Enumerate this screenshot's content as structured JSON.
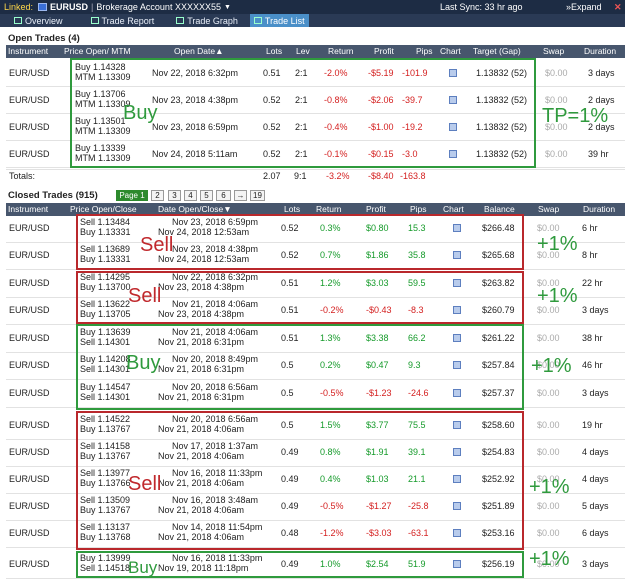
{
  "topbar": {
    "linked": "Linked:",
    "symbol": "EURUSD",
    "sep": "|",
    "account": "Brokerage Account XXXXXX55",
    "sync": "Last Sync: 33 hr ago",
    "expand": "»Expand",
    "close": "✕"
  },
  "tabs": [
    {
      "label": "Overview"
    },
    {
      "label": "Trade Report"
    },
    {
      "label": "Trade Graph"
    },
    {
      "label": "Trade List"
    }
  ],
  "open": {
    "title": "Open Trades (4)",
    "headers": [
      "Instrument",
      "Price Open/ MTM",
      "Open Date▲",
      "Lots",
      "Lev",
      "Return",
      "Profit",
      "Pips",
      "Chart",
      "Target (Gap)",
      "Swap",
      "Duration"
    ],
    "rows": [
      {
        "inst": "EUR/USD",
        "p1": "Buy 1.14328",
        "p2": "MTM 1.13309",
        "date": "Nov 22, 2018 6:32pm",
        "lots": "0.51",
        "lev": "2:1",
        "ret": "-2.0%",
        "profit": "-$5.19",
        "pips": "-101.9",
        "target": "1.13832 (52)",
        "swap": "$0.00",
        "dur": "3 days"
      },
      {
        "inst": "EUR/USD",
        "p1": "Buy 1.13706",
        "p2": "MTM 1.13309",
        "date": "Nov 23, 2018 4:38pm",
        "lots": "0.52",
        "lev": "2:1",
        "ret": "-0.8%",
        "profit": "-$2.06",
        "pips": "-39.7",
        "target": "1.13832 (52)",
        "swap": "$0.00",
        "dur": "2 days"
      },
      {
        "inst": "EUR/USD",
        "p1": "Buy 1.13501",
        "p2": "MTM 1.13309",
        "date": "Nov 23, 2018 6:59pm",
        "lots": "0.52",
        "lev": "2:1",
        "ret": "-0.4%",
        "profit": "-$1.00",
        "pips": "-19.2",
        "target": "1.13832 (52)",
        "swap": "$0.00",
        "dur": "2 days"
      },
      {
        "inst": "EUR/USD",
        "p1": "Buy 1.13339",
        "p2": "MTM 1.13309",
        "date": "Nov 24, 2018 5:11am",
        "lots": "0.52",
        "lev": "2:1",
        "ret": "-0.1%",
        "profit": "-$0.15",
        "pips": "-3.0",
        "target": "1.13832 (52)",
        "swap": "$0.00",
        "dur": "39 hr"
      }
    ],
    "totals": {
      "label": "Totals:",
      "lots": "2.07",
      "lev": "9:1",
      "ret": "-3.2%",
      "profit": "-$8.40",
      "pips": "-163.8"
    }
  },
  "closed": {
    "title": "Closed Trades (915)",
    "pages": [
      "Page 1",
      "2",
      "3",
      "4",
      "5",
      "6",
      "→",
      "19"
    ],
    "headers": [
      "Instrument",
      "Price Open/Close",
      "Date Open/Close▼",
      "Lots",
      "Return",
      "Profit",
      "Pips",
      "Chart",
      "Balance",
      "Swap",
      "Duration"
    ],
    "rows": [
      {
        "inst": "EUR/USD",
        "p1": "Sell 1.13484",
        "p2": "Buy 1.13331",
        "d1": "Nov 23, 2018 6:59pm",
        "d2": "Nov 24, 2018 12:53am",
        "lots": "0.52",
        "ret": "0.3%",
        "profit": "$0.80",
        "pips": "15.3",
        "bal": "$266.48",
        "swap": "$0.00",
        "dur": "6 hr"
      },
      {
        "inst": "EUR/USD",
        "p1": "Sell 1.13689",
        "p2": "Buy 1.13331",
        "d1": "Nov 23, 2018 4:38pm",
        "d2": "Nov 24, 2018 12:53am",
        "lots": "0.52",
        "ret": "0.7%",
        "profit": "$1.86",
        "pips": "35.8",
        "bal": "$265.68",
        "swap": "$0.00",
        "dur": "8 hr"
      },
      {
        "inst": "EUR/USD",
        "p1": "Sell 1.14295",
        "p2": "Buy 1.13700",
        "d1": "Nov 22, 2018 6:32pm",
        "d2": "Nov 23, 2018 4:38pm",
        "lots": "0.51",
        "ret": "1.2%",
        "profit": "$3.03",
        "pips": "59.5",
        "bal": "$263.82",
        "swap": "$0.00",
        "dur": "22 hr"
      },
      {
        "inst": "EUR/USD",
        "p1": "Sell 1.13622",
        "p2": "Buy 1.13705",
        "d1": "Nov 21, 2018 4:06am",
        "d2": "Nov 23, 2018 4:38pm",
        "lots": "0.51",
        "ret": "-0.2%",
        "profit": "-$0.43",
        "pips": "-8.3",
        "bal": "$260.79",
        "swap": "$0.00",
        "dur": "3 days"
      },
      {
        "inst": "EUR/USD",
        "p1": "Buy 1.13639",
        "p2": "Sell 1.14301",
        "d1": "Nov 21, 2018 4:06am",
        "d2": "Nov 21, 2018 6:31pm",
        "lots": "0.51",
        "ret": "1.3%",
        "profit": "$3.38",
        "pips": "66.2",
        "bal": "$261.22",
        "swap": "$0.00",
        "dur": "38 hr"
      },
      {
        "inst": "EUR/USD",
        "p1": "Buy 1.14208",
        "p2": "Sell 1.14301",
        "d1": "Nov 20, 2018 8:49pm",
        "d2": "Nov 21, 2018 6:31pm",
        "lots": "0.5",
        "ret": "0.2%",
        "profit": "$0.47",
        "pips": "9.3",
        "bal": "$257.84",
        "swap": "$0.00",
        "dur": "46 hr"
      },
      {
        "inst": "EUR/USD",
        "p1": "Buy 1.14547",
        "p2": "Sell 1.14301",
        "d1": "Nov 20, 2018 6:56am",
        "d2": "Nov 21, 2018 6:31pm",
        "lots": "0.5",
        "ret": "-0.5%",
        "profit": "-$1.23",
        "pips": "-24.6",
        "bal": "$257.37",
        "swap": "$0.00",
        "dur": "3 days"
      },
      {
        "inst": "EUR/USD",
        "p1": "Sell 1.14522",
        "p2": "Buy 1.13767",
        "d1": "Nov 20, 2018 6:56am",
        "d2": "Nov 21, 2018 4:06am",
        "lots": "0.5",
        "ret": "1.5%",
        "profit": "$3.77",
        "pips": "75.5",
        "bal": "$258.60",
        "swap": "$0.00",
        "dur": "19 hr"
      },
      {
        "inst": "EUR/USD",
        "p1": "Sell 1.14158",
        "p2": "Buy 1.13767",
        "d1": "Nov 17, 2018 1:37am",
        "d2": "Nov 21, 2018 4:06am",
        "lots": "0.49",
        "ret": "0.8%",
        "profit": "$1.91",
        "pips": "39.1",
        "bal": "$254.83",
        "swap": "$0.00",
        "dur": "4 days"
      },
      {
        "inst": "EUR/USD",
        "p1": "Sell 1.13977",
        "p2": "Buy 1.13766",
        "d1": "Nov 16, 2018 11:33pm",
        "d2": "Nov 21, 2018 4:06am",
        "lots": "0.49",
        "ret": "0.4%",
        "profit": "$1.03",
        "pips": "21.1",
        "bal": "$252.92",
        "swap": "$0.00",
        "dur": "4 days"
      },
      {
        "inst": "EUR/USD",
        "p1": "Sell 1.13509",
        "p2": "Buy 1.13767",
        "d1": "Nov 16, 2018 3:48am",
        "d2": "Nov 21, 2018 4:06am",
        "lots": "0.49",
        "ret": "-0.5%",
        "profit": "-$1.27",
        "pips": "-25.8",
        "bal": "$251.89",
        "swap": "$0.00",
        "dur": "5 days"
      },
      {
        "inst": "EUR/USD",
        "p1": "Sell 1.13137",
        "p2": "Buy 1.13768",
        "d1": "Nov 14, 2018 11:54pm",
        "d2": "Nov 21, 2018 4:06am",
        "lots": "0.48",
        "ret": "-1.2%",
        "profit": "-$3.03",
        "pips": "-63.1",
        "bal": "$253.16",
        "swap": "$0.00",
        "dur": "6 days"
      },
      {
        "inst": "EUR/USD",
        "p1": "Buy 1.13999",
        "p2": "Sell 1.14518",
        "d1": "Nov 16, 2018 11:33pm",
        "d2": "Nov 19, 2018 11:18pm",
        "lots": "0.49",
        "ret": "1.0%",
        "profit": "$2.54",
        "pips": "51.9",
        "bal": "$256.19",
        "swap": "$0.00",
        "dur": "3 days"
      }
    ]
  },
  "annotations": {
    "buy": "Buy",
    "tp": "TP=1%",
    "sell": "Sell",
    "plus": "+1%"
  }
}
